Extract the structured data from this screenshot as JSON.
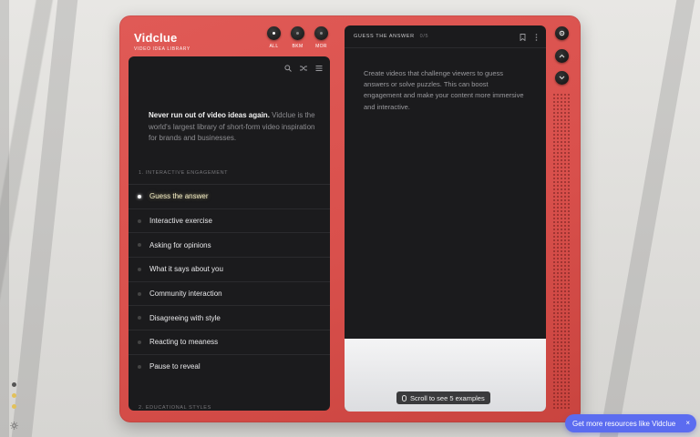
{
  "brand": {
    "title": "Vidclue",
    "subtitle": "VIDEO IDEA LIBRARY"
  },
  "filters": [
    {
      "label": "ALL",
      "active": true
    },
    {
      "label": "BKM",
      "active": false
    },
    {
      "label": "MOR",
      "active": false
    }
  ],
  "left_panel": {
    "intro_bold": "Never run out of video ideas again.",
    "intro_rest": " Vidclue is the world's largest library of short-form video inspiration for brands and businesses.",
    "section1": "1. INTERACTIVE ENGAGEMENT",
    "section2": "2. EDUCATIONAL STYLES",
    "items": [
      {
        "label": "Guess the answer",
        "active": true
      },
      {
        "label": "Interactive exercise"
      },
      {
        "label": "Asking for opinions"
      },
      {
        "label": "What it says about you"
      },
      {
        "label": "Community interaction"
      },
      {
        "label": "Disagreeing with style"
      },
      {
        "label": "Reacting to meaness"
      },
      {
        "label": "Pause to reveal"
      }
    ],
    "tools": [
      "search-icon",
      "shuffle-icon",
      "menu-icon"
    ]
  },
  "right_panel": {
    "title": "GUESS THE ANSWER",
    "count": "0/5",
    "description": "Create videos that challenge viewers to guess answers or solve puzzles. This can boost engagement and make your content more immersive and interactive.",
    "scroll_hint": "Scroll to see 5 examples",
    "actions": [
      "bookmark-icon",
      "more-vertical-icon"
    ]
  },
  "rail": [
    "settings-icon",
    "chevron-up-icon",
    "chevron-down-icon"
  ],
  "promo": {
    "label": "Get more resources like Vidclue",
    "close": "×"
  },
  "colors": {
    "device": "#d9504c",
    "panel": "#1b1b1d",
    "promo": "#5b6cf0"
  }
}
